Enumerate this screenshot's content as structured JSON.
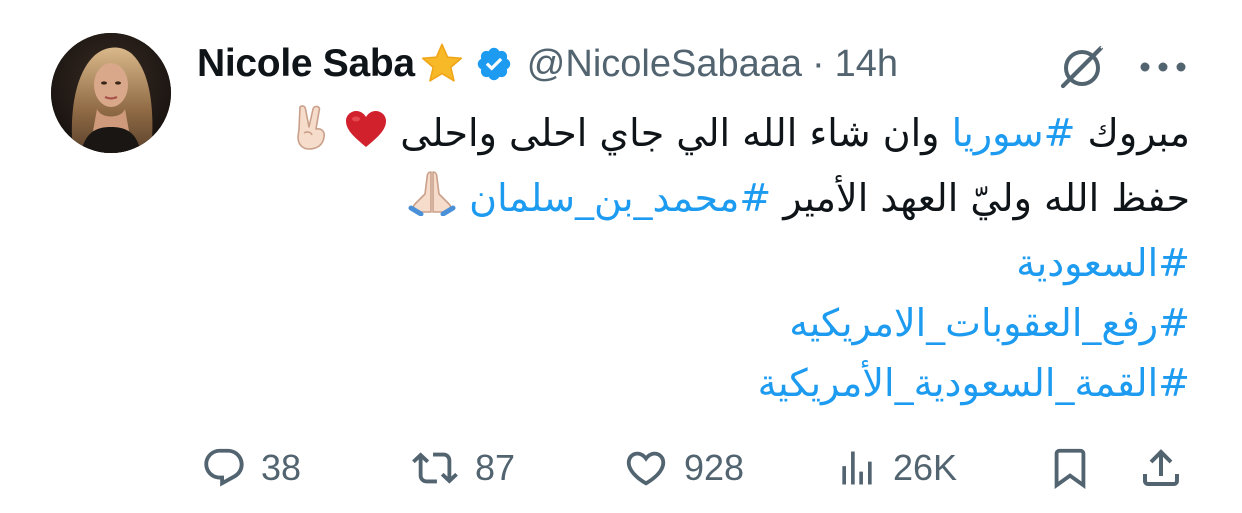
{
  "tweet": {
    "author": {
      "display_name": "Nicole Saba",
      "handle": "@NicoleSabaaa",
      "separator": "·",
      "time": "14h"
    },
    "lines": [
      {
        "parts": [
          {
            "text": "مبروك ",
            "hashtag": false
          },
          {
            "text": "#سوريا",
            "hashtag": true
          },
          {
            "text": " وان شاء الله الي جاي احلى واحلى",
            "hashtag": false
          }
        ],
        "trailing_icons": [
          "red-heart-icon",
          "victory-hand-icon"
        ]
      },
      {
        "parts": [
          {
            "text": "حفظ الله وليّ العهد الأمير ",
            "hashtag": false
          },
          {
            "text": "#محمد_بن_سلمان",
            "hashtag": true
          }
        ],
        "trailing_icons": [
          "folded-hands-icon"
        ]
      },
      {
        "parts": [
          {
            "text": "#السعودية",
            "hashtag": true
          }
        ],
        "trailing_icons": []
      },
      {
        "parts": [
          {
            "text": "#رفع_العقوبات_الامريكيه",
            "hashtag": true
          }
        ],
        "trailing_icons": []
      },
      {
        "parts": [
          {
            "text": "#القمة_السعودية_الأمريكية",
            "hashtag": true
          }
        ],
        "trailing_icons": []
      }
    ],
    "actions": {
      "replies": "38",
      "reposts": "87",
      "likes": "928",
      "views": "26K"
    },
    "colors": {
      "text": "#0f1419",
      "secondary": "#536471",
      "accent": "#1d9bf0",
      "verified": "#1d9bf0",
      "star": "#f7b928",
      "heart": "#d0212c"
    }
  }
}
